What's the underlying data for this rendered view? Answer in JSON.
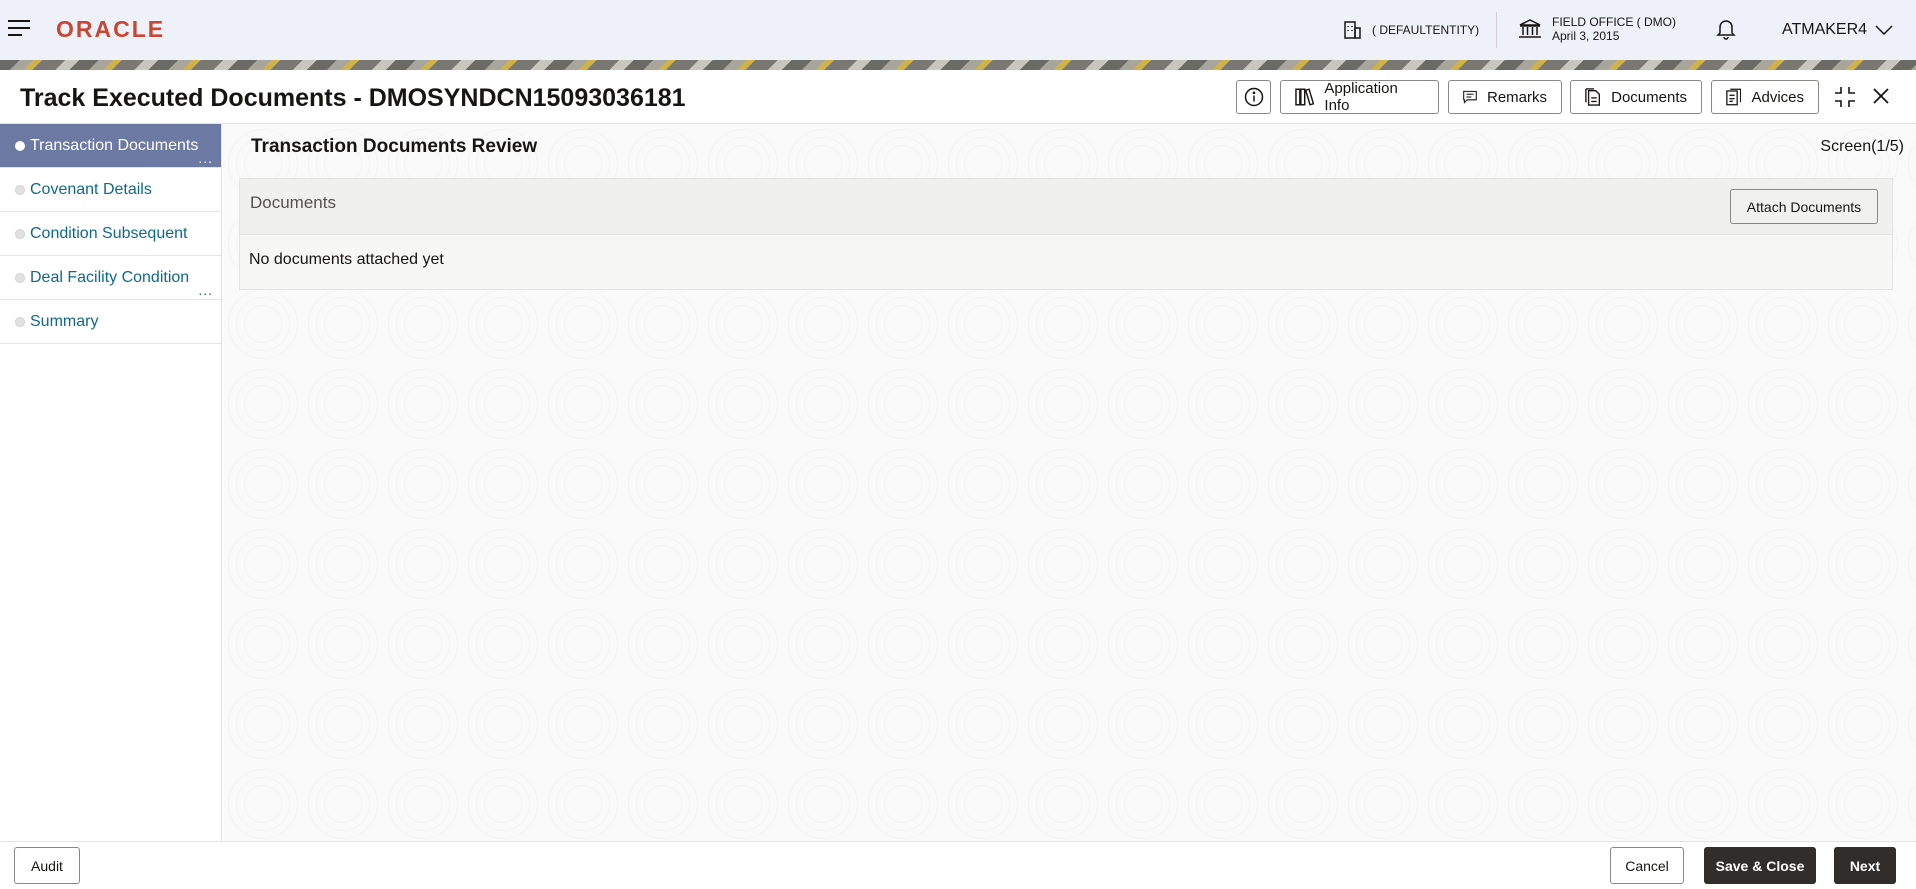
{
  "header": {
    "logo": "ORACLE",
    "entity": "( DEFAULTENTITY)",
    "office_name": "FIELD OFFICE ( DMO)",
    "office_date": "April 3, 2015",
    "user": "ATMAKER4"
  },
  "title": {
    "text": "Track Executed Documents - DMOSYNDCN15093036181",
    "buttons": {
      "application_info": "Application Info",
      "remarks": "Remarks",
      "documents": "Documents",
      "advices": "Advices"
    }
  },
  "sidebar": {
    "items": [
      {
        "label": "Transaction Documents",
        "active": true
      },
      {
        "label": "Covenant Details",
        "active": false
      },
      {
        "label": "Condition Subsequent",
        "active": false
      },
      {
        "label": "Deal Facility Condition",
        "active": false
      },
      {
        "label": "Summary",
        "active": false
      }
    ],
    "more": "..."
  },
  "main": {
    "section_title": "Transaction Documents Review",
    "screen_indicator": "Screen(1/5)",
    "documents_label": "Documents",
    "attach_button": "Attach Documents",
    "empty_message": "No documents attached yet"
  },
  "footer": {
    "audit": "Audit",
    "cancel": "Cancel",
    "save_close": "Save & Close",
    "next": "Next"
  },
  "colors": {
    "brand": "#c74634",
    "active_nav": "#6c7aa3",
    "link": "#0e6a8c",
    "primary_button": "#312d2a"
  }
}
